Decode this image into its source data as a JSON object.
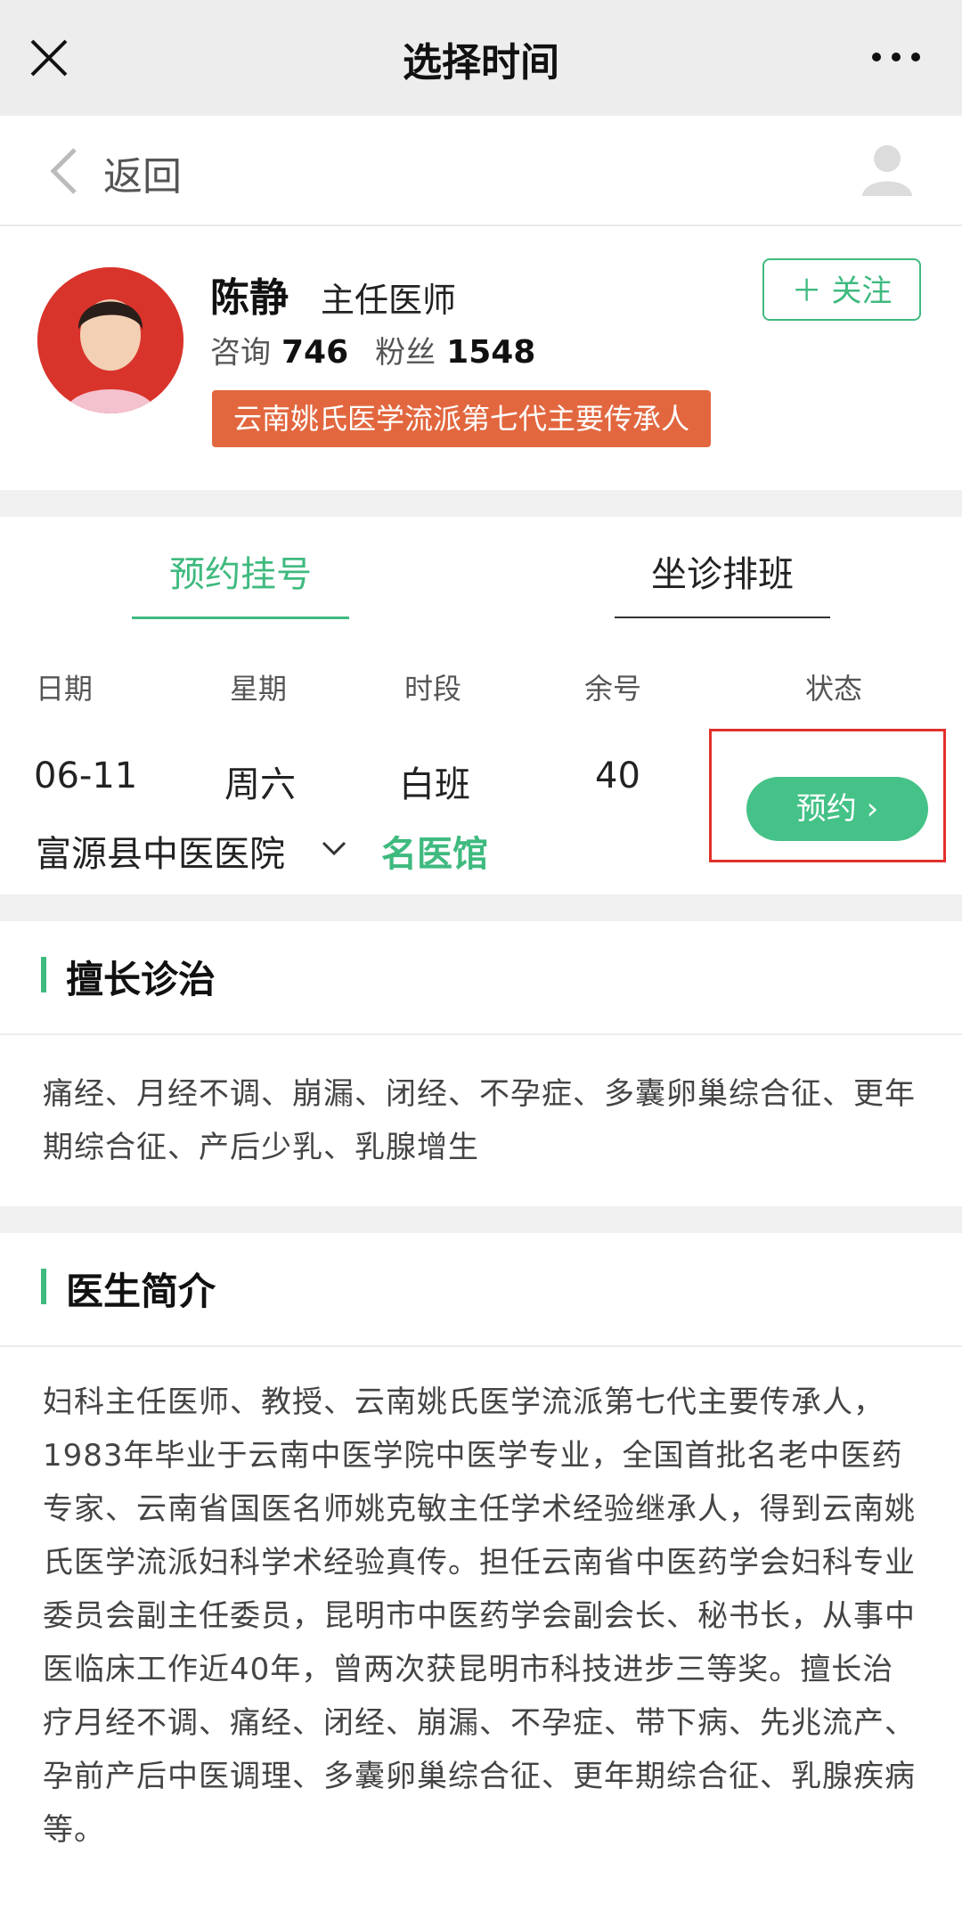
{
  "topbar": {
    "title": "选择时间"
  },
  "backbar": {
    "label": "返回"
  },
  "doctor": {
    "name": "陈静",
    "title": "主任医师",
    "consult_label": "咨询",
    "consult_count": "746",
    "fans_label": "粉丝",
    "fans_count": "1548",
    "tagline": "云南姚氏医学流派第七代主要传承人",
    "follow_label": "＋ 关注"
  },
  "schedule": {
    "tabs": [
      "预约挂号",
      "坐诊排班"
    ],
    "columns": [
      "日期",
      "星期",
      "时段",
      "余号",
      "状态"
    ],
    "row": {
      "date": "06-11",
      "weekday": "周六",
      "period": "白班",
      "remaining": "40",
      "hospital": "富源县中医医院",
      "clinic": "名医馆",
      "button": "预约 ›"
    }
  },
  "specialty": {
    "title": "擅长诊治",
    "text": "痛经、月经不调、崩漏、闭经、不孕症、多囊卵巢综合征、更年期综合征、产后少乳、乳腺增生"
  },
  "intro": {
    "title": "医生简介",
    "text": "妇科主任医师、教授、云南姚氏医学流派第七代主要传承人，1983年毕业于云南中医学院中医学专业，全国首批名老中医药专家、云南省国医名师姚克敏主任学术经验继承人，得到云南姚氏医学流派妇科学术经验真传。担任云南省中医药学会妇科专业委员会副主任委员，昆明市中医药学会副会长、秘书长，从事中医临床工作近40年，曾两次获昆明市科技进步三等奖。擅长治疗月经不调、痛经、闭经、崩漏、不孕症、带下病、先兆流产、孕前产后中医调理、多囊卵巢综合征、更年期综合征、乳腺疾病等。"
  },
  "icons": [
    "close-icon",
    "more-icon",
    "back-chevron-icon",
    "user-icon",
    "avatar",
    "chevron-down-icon"
  ],
  "colors": {
    "accent": "#3fba7f",
    "tag": "#e2673f",
    "highlight": "#e0312a"
  }
}
